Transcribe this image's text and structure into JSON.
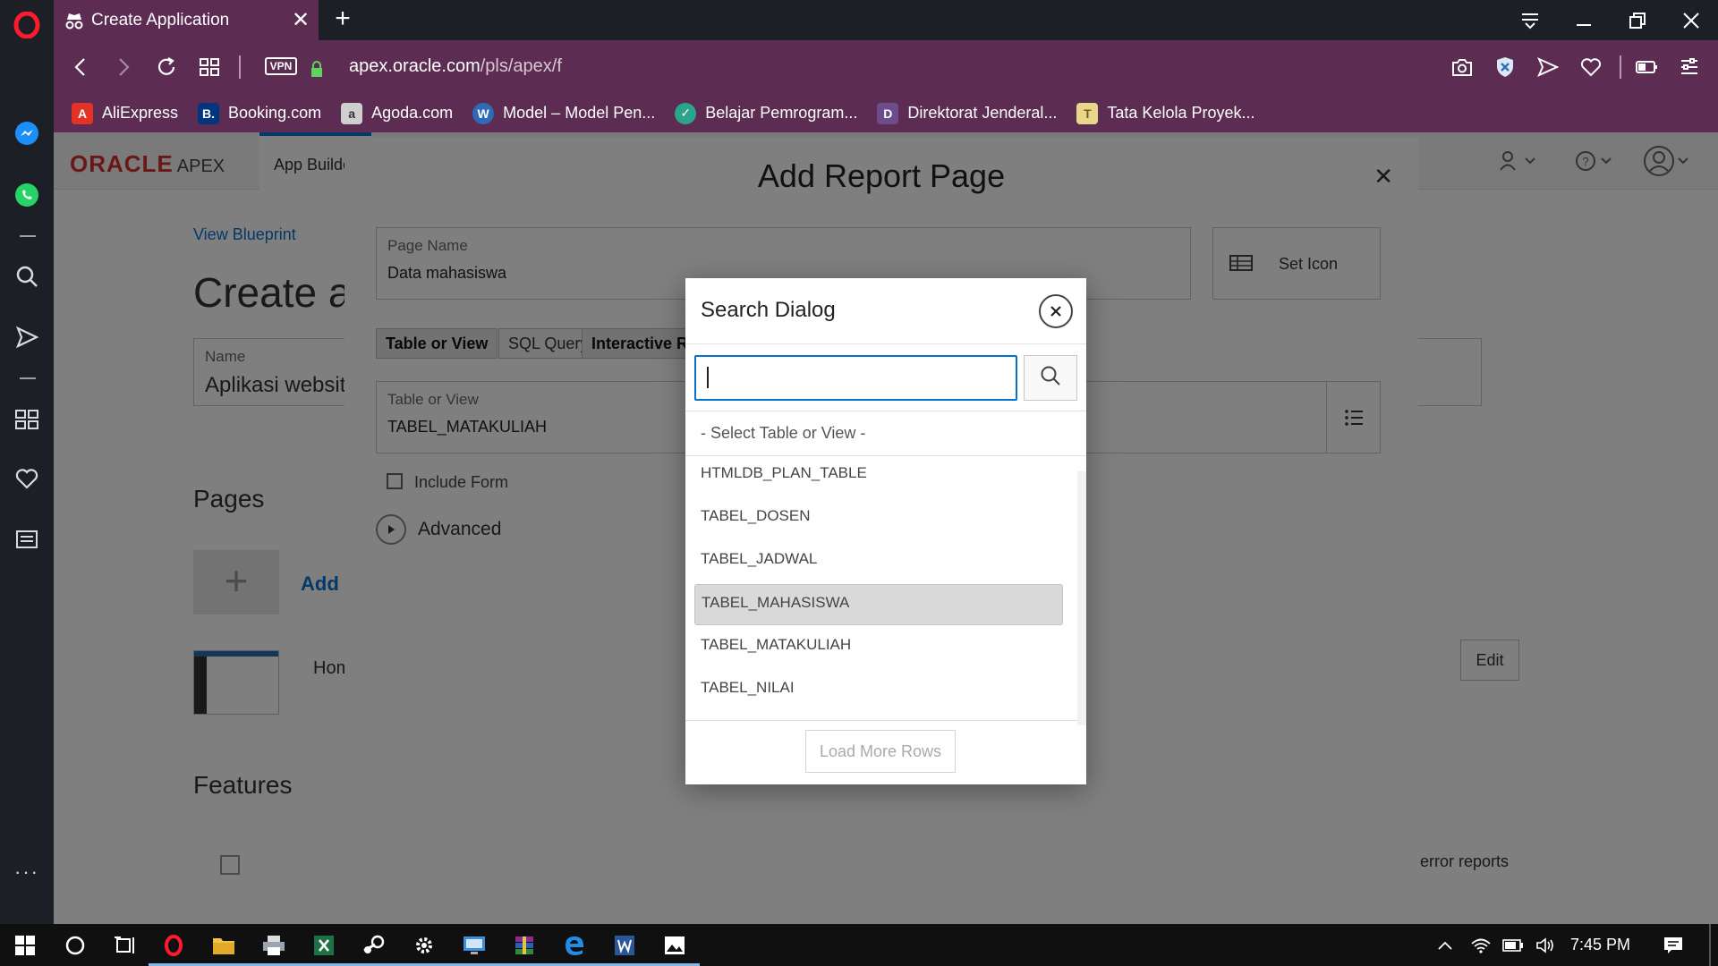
{
  "browser": {
    "tab_title": "Create Application",
    "url_host": "apex.oracle.com",
    "url_path": "/pls/apex/f",
    "vpn_label": "VPN",
    "tab_close_glyph": "✕",
    "new_tab_glyph": "+"
  },
  "bookmarks": [
    {
      "label": "AliExpress",
      "icon": "aliexpress-icon",
      "color": "#e43225",
      "glyph": "A"
    },
    {
      "label": "Booking.com",
      "icon": "booking-icon",
      "color": "#003580",
      "glyph": "B."
    },
    {
      "label": "Agoda.com",
      "icon": "agoda-icon",
      "color": "#cfcfcf",
      "glyph": "a"
    },
    {
      "label": "Model – Model Pen...",
      "icon": "wordpress-icon",
      "color": "#2e6ab5",
      "glyph": "W"
    },
    {
      "label": "Belajar Pemrogram...",
      "icon": "belajar-icon",
      "color": "#2aa58c",
      "glyph": "✓"
    },
    {
      "label": "Direktorat Jenderal...",
      "icon": "direktorat-icon",
      "color": "#6c4c8a",
      "glyph": "D"
    },
    {
      "label": "Tata Kelola Proyek...",
      "icon": "tata-kelola-icon",
      "color": "#e8d78a",
      "glyph": "T"
    }
  ],
  "apex_header": {
    "logo_oracle": "ORACLE",
    "logo_apex": "APEX",
    "app_builder_tab": "App Builder"
  },
  "background_page": {
    "view_blueprint": "View Blueprint",
    "page_title": "Create an Application",
    "name_label": "Name",
    "name_value": "Aplikasi website",
    "pages_heading": "Pages",
    "add_page": "Add Page",
    "home_page": "Home",
    "edit_button": "Edit",
    "features_heading": "Features",
    "error_reports_text": "d error reports"
  },
  "report_dialog": {
    "title": "Add Report Page",
    "close_glyph": "✕",
    "page_name_label": "Page Name",
    "page_name_value": "Data mahasiswa",
    "set_icon_label": "Set Icon",
    "source_options": [
      "Table or View",
      "SQL Query"
    ],
    "selected_source": "Table or View",
    "report_type_label": "Interactive Report",
    "table_label": "Table or View",
    "table_value": "TABEL_MATAKULIAH",
    "include_form_label": "Include Form",
    "advanced_label": "Advanced"
  },
  "search_dialog": {
    "title": "Search Dialog",
    "search_value": "",
    "null_option": "- Select Table or View -",
    "rows": [
      "HTMLDB_PLAN_TABLE",
      "TABEL_DOSEN",
      "TABEL_JADWAL",
      "TABEL_MAHASISWA",
      "TABEL_MATAKULIAH",
      "TABEL_NILAI"
    ],
    "highlighted_row": "TABEL_MAHASISWA",
    "load_more_label": "Load More Rows"
  },
  "taskbar": {
    "clock": "7:45 PM",
    "pinned": [
      "windows-start-icon",
      "cortana-icon",
      "task-view-icon",
      "opera-icon",
      "file-explorer-icon",
      "printer-icon",
      "excel-icon",
      "steam-icon",
      "settings-icon",
      "remote-desktop-icon",
      "winrar-icon",
      "edge-icon",
      "word-icon",
      "photos-icon"
    ]
  }
}
